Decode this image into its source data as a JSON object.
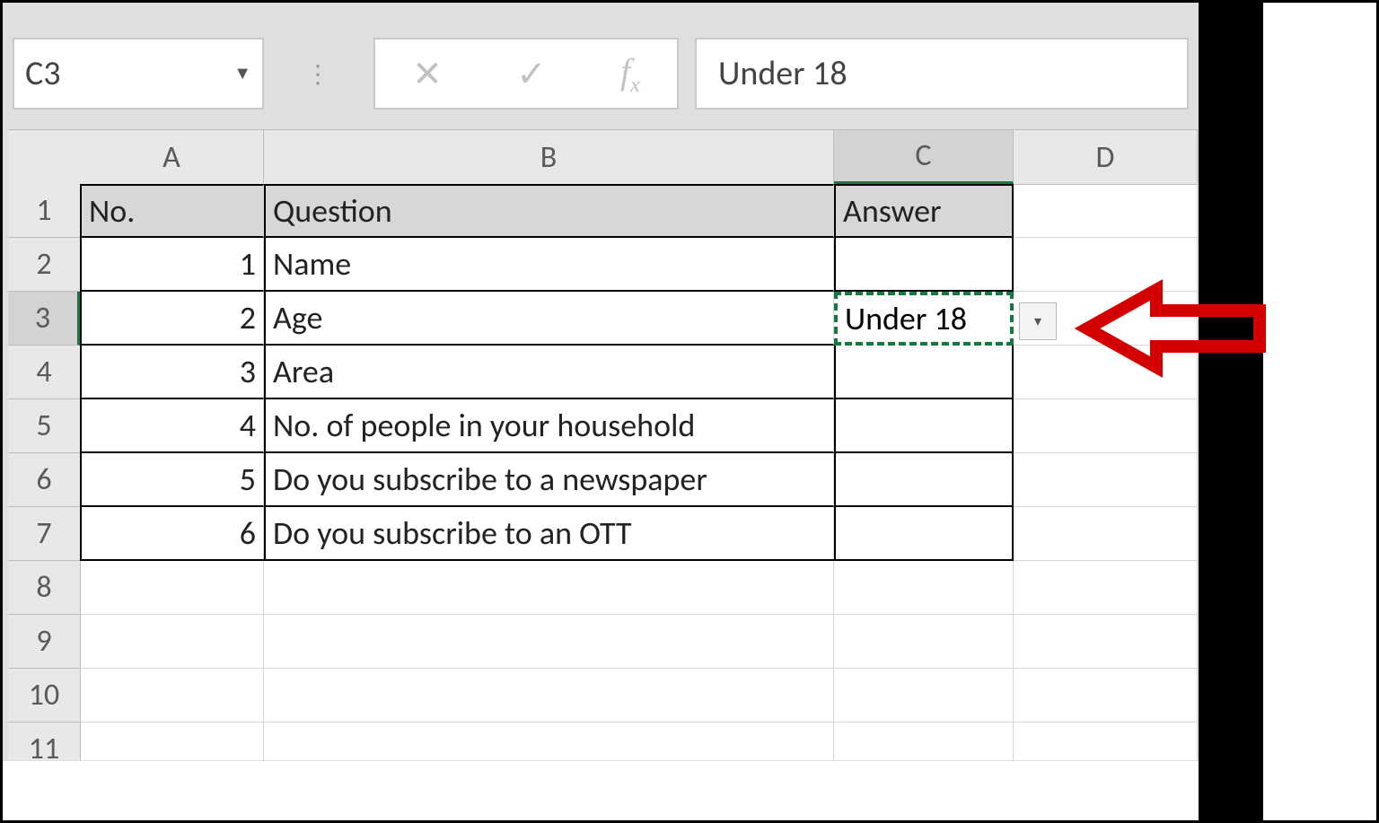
{
  "formula_bar": {
    "cell_ref": "C3",
    "value": "Under 18"
  },
  "columns": [
    "A",
    "B",
    "C",
    "D"
  ],
  "rows": [
    "1",
    "2",
    "3",
    "4",
    "5",
    "6",
    "7",
    "8",
    "9",
    "10",
    "11"
  ],
  "selected_cell": {
    "row": 3,
    "col": "C"
  },
  "table": {
    "headers": {
      "A": "No.",
      "B": "Question",
      "C": "Answer"
    },
    "rows": [
      {
        "no": "1",
        "q": "Name",
        "a": ""
      },
      {
        "no": "2",
        "q": "Age",
        "a": "Under 18"
      },
      {
        "no": "3",
        "q": "Area",
        "a": ""
      },
      {
        "no": "4",
        "q": "No. of people in your household",
        "a": ""
      },
      {
        "no": "5",
        "q": "Do you subscribe to a newspaper",
        "a": ""
      },
      {
        "no": "6",
        "q": "Do you subscribe to an OTT",
        "a": ""
      }
    ]
  }
}
